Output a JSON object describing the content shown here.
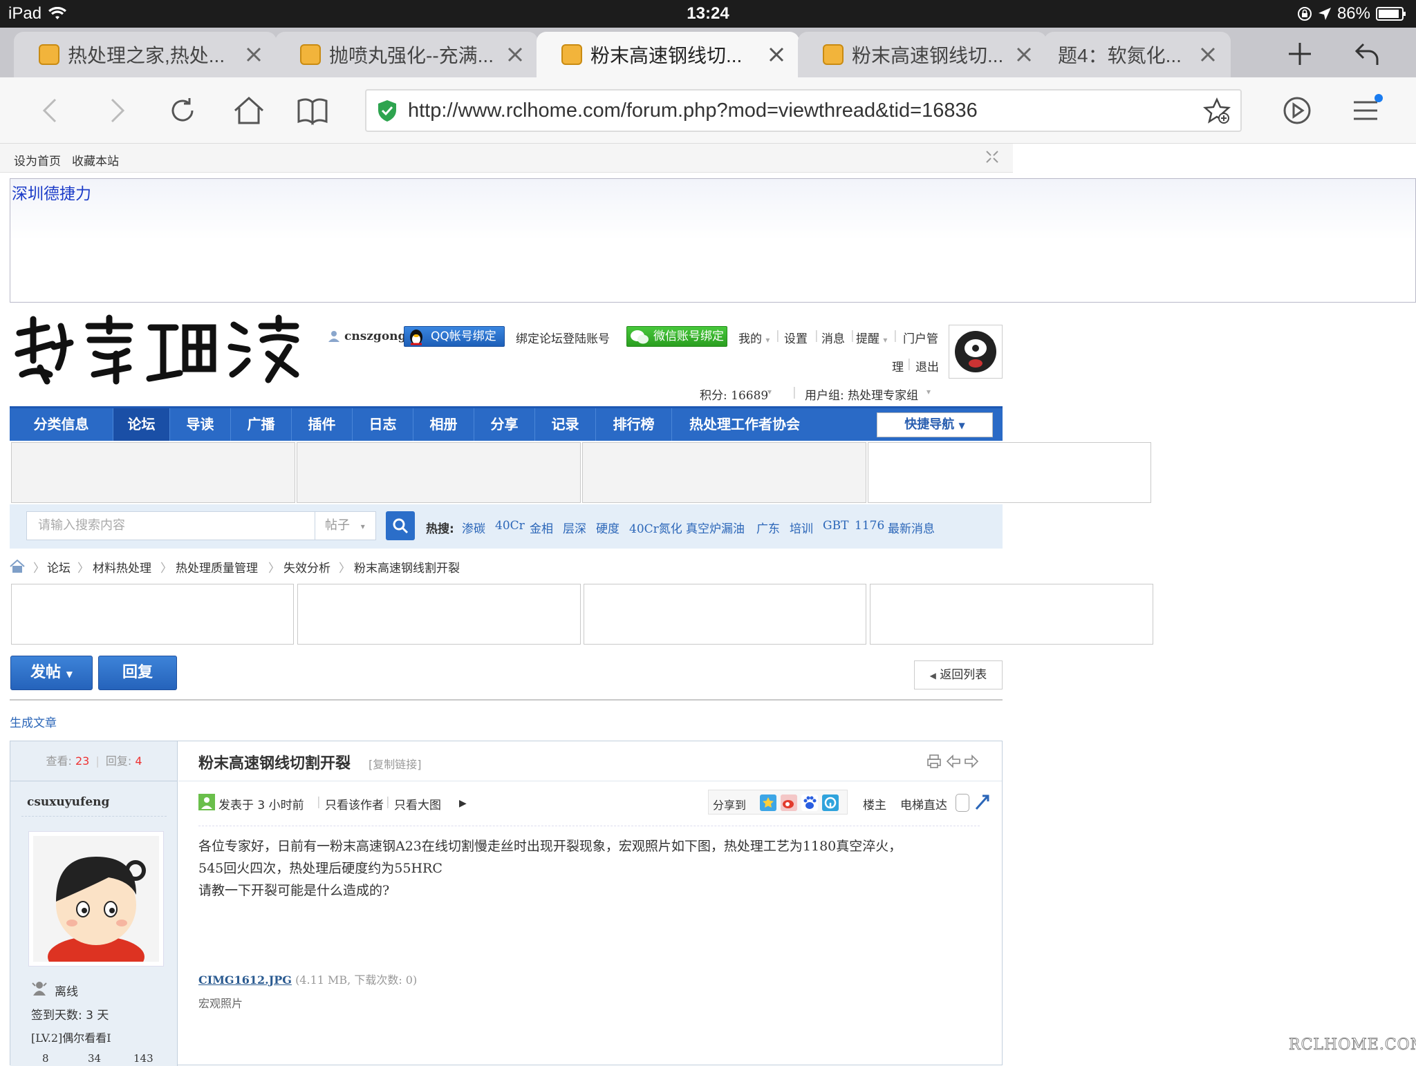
{
  "statusbar": {
    "device": "iPad",
    "time": "13:24",
    "battery": "86%"
  },
  "tabs": [
    {
      "title": "热处理之家,热处..."
    },
    {
      "title": "抛喷丸强化--充满..."
    },
    {
      "title": "粉末高速钢线切..."
    },
    {
      "title": "粉末高速钢线切..."
    },
    {
      "title": "题4：软氮化..."
    }
  ],
  "browser": {
    "url": "http://www.rclhome.com/forum.php?mod=viewthread&tid=16836"
  },
  "topstrip": {
    "set_home": "设为首页",
    "bookmark": "收藏本站"
  },
  "ad": {
    "text": "深圳德捷力"
  },
  "user": {
    "name": "cnszgong",
    "qq_bind": "QQ帐号绑定",
    "bind_forum": "绑定论坛登陆账号",
    "wechat_bind": "微信账号绑定",
    "mine": "我的",
    "settings": "设置",
    "messages": "消息",
    "reminders": "提醒",
    "portal_manage_1": "门户管",
    "portal_manage_2": "理",
    "logout": "退出",
    "points": "积分: 16689",
    "group": "用户组: 热处理专家组"
  },
  "nav": {
    "items": [
      "分类信息",
      "论坛",
      "导读",
      "广播",
      "插件",
      "日志",
      "相册",
      "分享",
      "记录",
      "排行榜",
      "热处理工作者协会"
    ],
    "quick": "快捷导航"
  },
  "search": {
    "placeholder": "请输入搜索内容",
    "type": "帖子",
    "hot_label": "热搜:",
    "hot": [
      "渗碳",
      "40Cr",
      "金相",
      "层深",
      "硬度",
      "40Cr氮化",
      "真空炉漏油",
      "广东",
      "培训",
      "GBT",
      "1176",
      "最新消息"
    ]
  },
  "breadcrumb": [
    "论坛",
    "材料热处理",
    "热处理质量管理",
    "失效分析",
    "粉末高速钢线割开裂"
  ],
  "actions": {
    "post": "发帖",
    "reply": "回复",
    "back_list": "返回列表",
    "gen_article": "生成文章"
  },
  "thread": {
    "views_label": "查看:",
    "views": "23",
    "replies_label": "回复:",
    "replies": "4",
    "title": "粉末高速钢线切割开裂",
    "copy_link": "[复制链接]",
    "posted": "发表于 3 小时前",
    "only_author": "只看该作者",
    "only_big": "只看大图",
    "share_to": "分享到",
    "floor": "楼主",
    "elevator": "电梯直达",
    "body_line1": "各位专家好，日前有一粉末高速钢A23在线切割慢走丝时出现开裂现象，宏观照片如下图，热处理工艺为1180真空淬火，",
    "body_line2": "545回火四次，热处理后硬度约为55HRC",
    "body_line3": "请教一下开裂可能是什么造成的?",
    "attachment_name": "CIMG1612.JPG",
    "attachment_info": "(4.11 MB, 下载次数: 0)",
    "caption": "宏观照片"
  },
  "author": {
    "name": "csuxuyufeng",
    "status": "离线",
    "sign_days": "签到天数: 3 天",
    "level": "[LV.2]偶尔看看I",
    "stats": [
      "8",
      "34",
      "143"
    ]
  },
  "watermark": "RCLHOME.COM"
}
